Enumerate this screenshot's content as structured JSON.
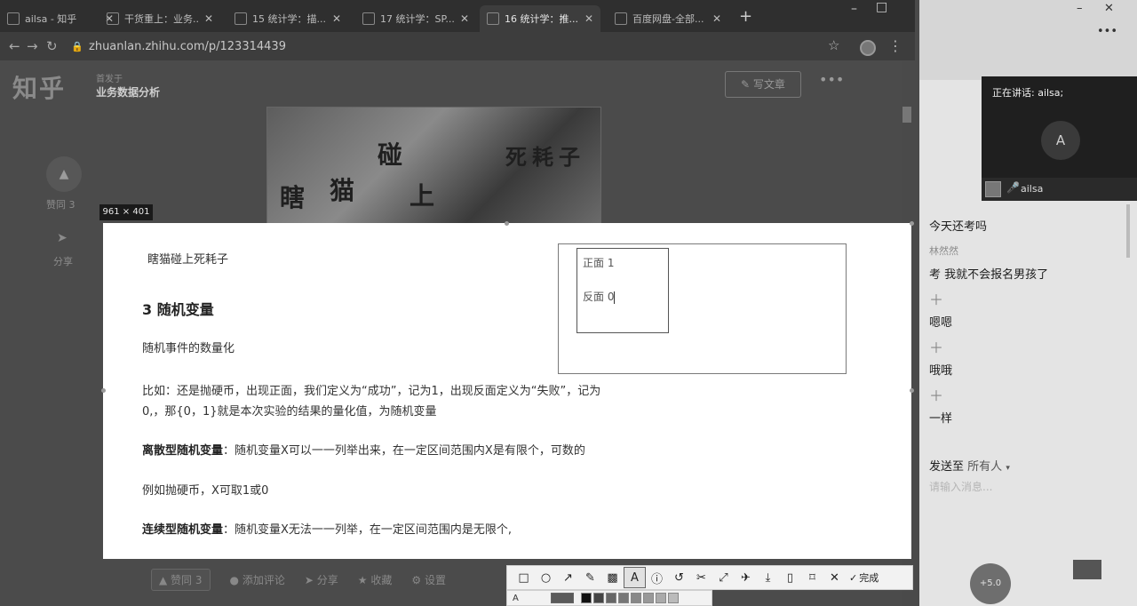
{
  "browser": {
    "tabs": [
      {
        "title": "ailsa - 知乎",
        "active": false
      },
      {
        "title": "干货重上：业务...",
        "active": false
      },
      {
        "title": "15 统计学：描...",
        "active": false
      },
      {
        "title": "17 统计学：SP...",
        "active": false
      },
      {
        "title": "16 统计学：推...",
        "active": true
      },
      {
        "title": "百度网盘-全部...",
        "active": false
      }
    ],
    "url": "zhuanlan.zhihu.com/p/123314439"
  },
  "page": {
    "logo": "知乎",
    "published_label": "首发于",
    "column_name": "业务数据分析",
    "write_button": "写文章",
    "sidebar_agree": "赞同 3",
    "sidebar_share": "分享",
    "bottom_bar": {
      "agree": "▲ 赞同 3",
      "comment": "添加评论",
      "share": "分享",
      "favorite": "收藏",
      "settings": "设置"
    },
    "banner_chars": [
      "瞎",
      "猫",
      "碰",
      "上",
      "死",
      "耗",
      "子"
    ]
  },
  "capture": {
    "size_label": "961 × 401",
    "caption": "瞎猫碰上死耗子",
    "heading": "3 随机变量",
    "line1": "随机事件的数量化",
    "line2a": "比如：还是抛硬币，出现正面，我们定义为“成功”，记为1，出现反面定义为“失败”，记为",
    "line2b": "0,，那{0，1}就是本次实验的结果的量化值，为随机变量",
    "discrete_term": "离散型随机变量",
    "discrete_text": "：随机变量X可以一一列举出来，在一定区间范围内X是有限个，可数的",
    "example": "例如抛硬币，X可取1或0",
    "continuous_term": "连续型随机变量",
    "continuous_text": "：随机变量X无法一一列举，在一定区间范围内是无限个,",
    "note_line1": "正面 1",
    "note_line2": "反面 0"
  },
  "toolbar": {
    "done_label": "完成"
  },
  "chat": {
    "speaking_label": "正在讲话: ailsa;",
    "video_avatar": "A",
    "video_name": "ailsa",
    "messages": [
      {
        "type": "text",
        "text": "今天还考吗"
      },
      {
        "type": "user",
        "text": "林然然"
      },
      {
        "type": "text",
        "text": "考 我就不会报名男孩了"
      },
      {
        "type": "plus",
        "text": "＋"
      },
      {
        "type": "text",
        "text": "嗯嗯"
      },
      {
        "type": "plus",
        "text": "＋"
      },
      {
        "type": "text",
        "text": "哦哦"
      },
      {
        "type": "plus",
        "text": "＋"
      },
      {
        "type": "text",
        "text": "一样"
      }
    ],
    "send_to_label": "发送至",
    "send_to_value": "所有人",
    "input_placeholder": "请输入消息...",
    "bottom_circle": "+5.0"
  },
  "colors": {
    "overlay_dim": "#4b4b4b",
    "capture_bg": "#ffffff",
    "video_bg": "#1f1f1f"
  }
}
